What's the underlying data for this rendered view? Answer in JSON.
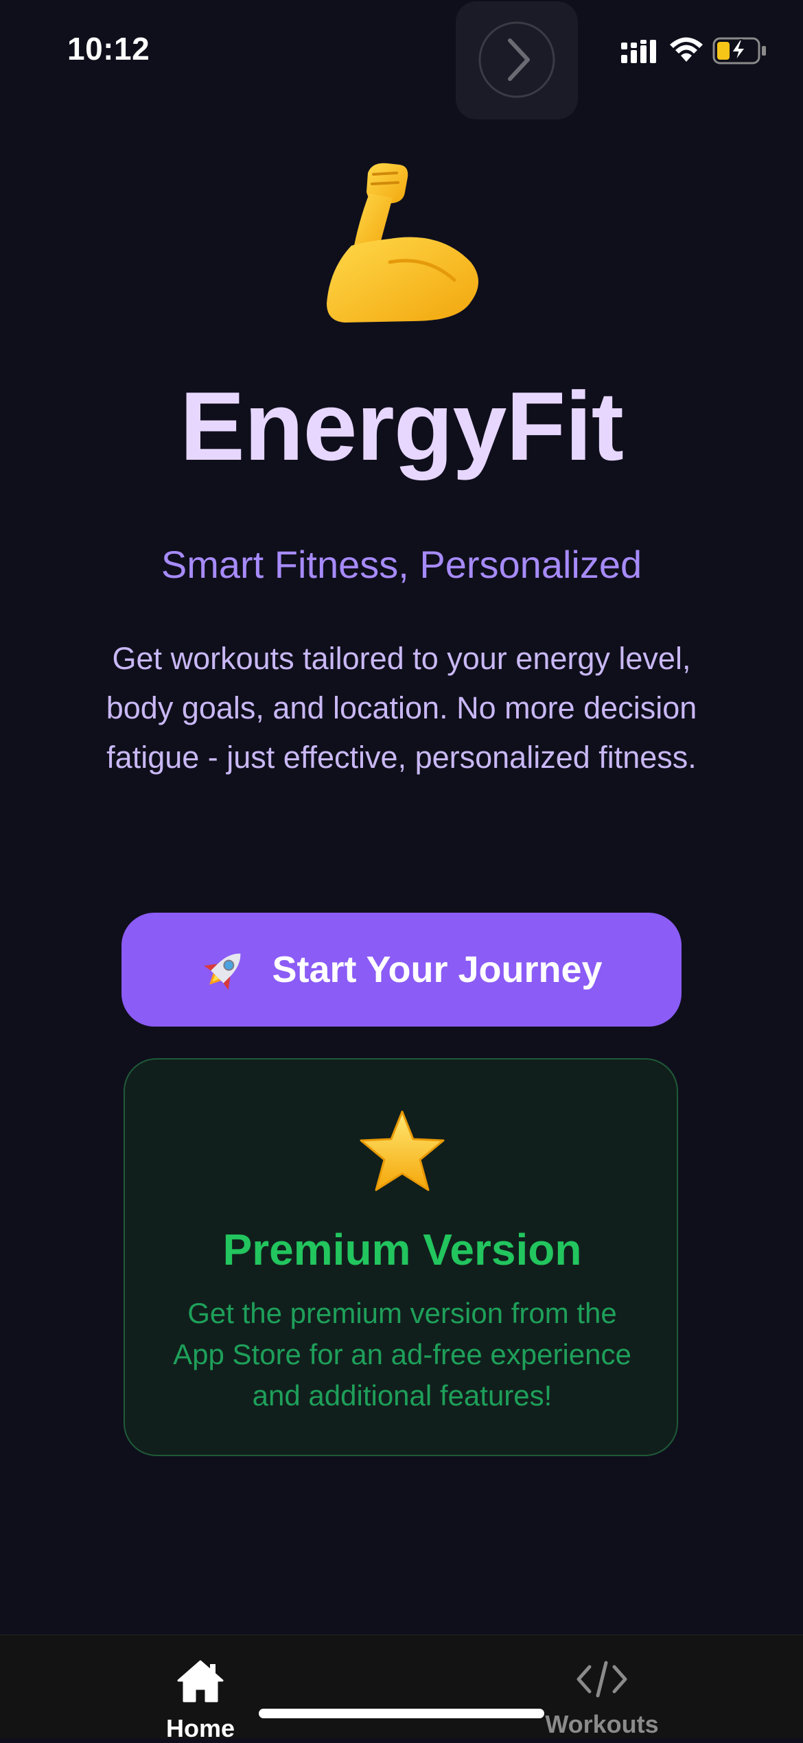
{
  "status_bar": {
    "time": "10:12"
  },
  "hero": {
    "icon": "flexed-biceps-icon",
    "title": "EnergyFit",
    "tagline": "Smart Fitness, Personalized",
    "description": "Get workouts tailored to your energy level, body goals, and location. No more decision fatigue - just effective, personalized fitness."
  },
  "cta": {
    "icon": "rocket-icon",
    "label": "Start Your Journey"
  },
  "premium": {
    "icon": "star-icon",
    "title": "Premium Version",
    "text": "Get the premium version from the App Store for an ad-free experience and additional features!"
  },
  "tab_bar": {
    "items": [
      {
        "label": "Home",
        "icon": "home-icon",
        "active": true
      },
      {
        "label": "Workouts",
        "icon": "code-icon",
        "active": false
      }
    ]
  },
  "colors": {
    "background": "#0f0f1c",
    "accent": "#8b5cf6",
    "title": "#e7d7ff",
    "premium_green": "#22c55e"
  }
}
